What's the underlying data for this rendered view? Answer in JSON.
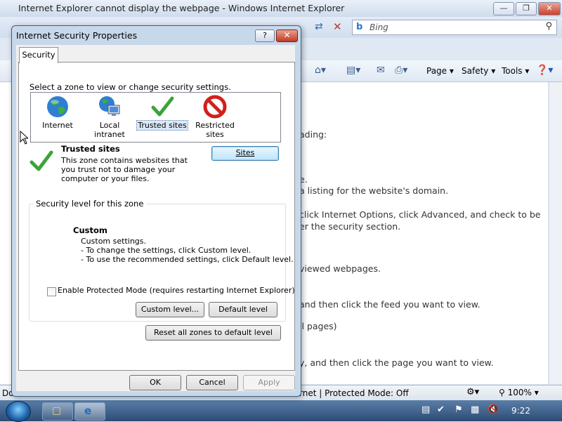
{
  "ie": {
    "title": "Internet Explorer cannot display the webpage - Windows Internet Explorer",
    "search_placeholder": "Bing",
    "commands": {
      "page": "Page",
      "safety": "Safety",
      "tools": "Tools"
    },
    "content_lines": [
      "ading:",
      "e.",
      "a listing for the website's domain.",
      "click Internet Options, click Advanced, and check to be",
      "er the security section.",
      "viewed webpages.",
      "and then click the feed you want to view.",
      "ll pages)",
      "y, and then click the page you want to view."
    ],
    "status_left": "Do",
    "status_zone": "rnet | Protected Mode: Off",
    "zoom": "100%"
  },
  "taskbar": {
    "clock": "9:22"
  },
  "dialog": {
    "title": "Internet Security Properties",
    "tab": "Security",
    "zone_prompt": "Select a zone to view or change security settings.",
    "zones": [
      {
        "label": "Internet"
      },
      {
        "label": "Local intranet"
      },
      {
        "label": "Trusted sites"
      },
      {
        "label": "Restricted sites"
      }
    ],
    "selected_zone_name": "Trusted sites",
    "selected_zone_desc": "This zone contains websites that you trust not to damage your computer or your files.",
    "sites_button": "Sites",
    "level_legend": "Security level for this zone",
    "level_name": "Custom",
    "level_desc": [
      "Custom settings.",
      "- To change the settings, click Custom level.",
      "- To use the recommended settings, click Default level."
    ],
    "protected_mode_label": "Enable Protected Mode (requires restarting Internet Explorer)",
    "custom_level_button": "Custom level...",
    "default_level_button": "Default level",
    "reset_button": "Reset all zones to default level",
    "ok_button": "OK",
    "cancel_button": "Cancel",
    "apply_button": "Apply"
  }
}
